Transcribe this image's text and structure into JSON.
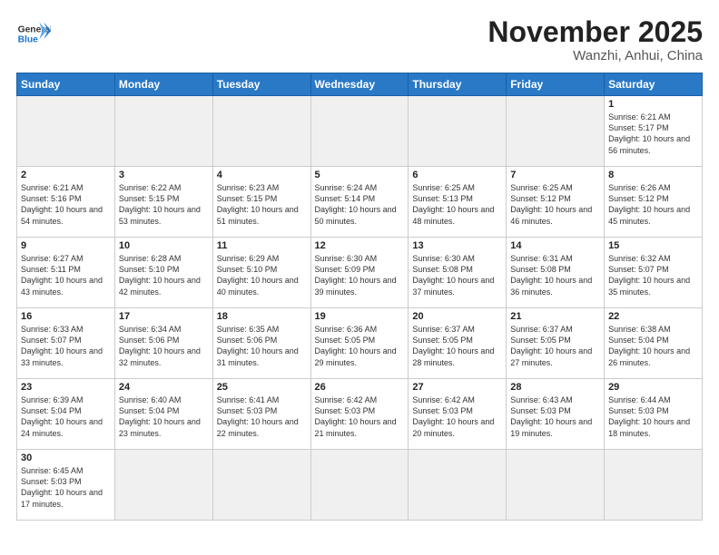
{
  "header": {
    "logo_general": "General",
    "logo_blue": "Blue",
    "month_title": "November 2025",
    "subtitle": "Wanzhi, Anhui, China"
  },
  "days_of_week": [
    "Sunday",
    "Monday",
    "Tuesday",
    "Wednesday",
    "Thursday",
    "Friday",
    "Saturday"
  ],
  "weeks": [
    [
      {
        "day": "",
        "info": ""
      },
      {
        "day": "",
        "info": ""
      },
      {
        "day": "",
        "info": ""
      },
      {
        "day": "",
        "info": ""
      },
      {
        "day": "",
        "info": ""
      },
      {
        "day": "",
        "info": ""
      },
      {
        "day": "1",
        "info": "Sunrise: 6:21 AM\nSunset: 5:17 PM\nDaylight: 10 hours and 56 minutes."
      }
    ],
    [
      {
        "day": "2",
        "info": "Sunrise: 6:21 AM\nSunset: 5:16 PM\nDaylight: 10 hours and 54 minutes."
      },
      {
        "day": "3",
        "info": "Sunrise: 6:22 AM\nSunset: 5:15 PM\nDaylight: 10 hours and 53 minutes."
      },
      {
        "day": "4",
        "info": "Sunrise: 6:23 AM\nSunset: 5:15 PM\nDaylight: 10 hours and 51 minutes."
      },
      {
        "day": "5",
        "info": "Sunrise: 6:24 AM\nSunset: 5:14 PM\nDaylight: 10 hours and 50 minutes."
      },
      {
        "day": "6",
        "info": "Sunrise: 6:25 AM\nSunset: 5:13 PM\nDaylight: 10 hours and 48 minutes."
      },
      {
        "day": "7",
        "info": "Sunrise: 6:25 AM\nSunset: 5:12 PM\nDaylight: 10 hours and 46 minutes."
      },
      {
        "day": "8",
        "info": "Sunrise: 6:26 AM\nSunset: 5:12 PM\nDaylight: 10 hours and 45 minutes."
      }
    ],
    [
      {
        "day": "9",
        "info": "Sunrise: 6:27 AM\nSunset: 5:11 PM\nDaylight: 10 hours and 43 minutes."
      },
      {
        "day": "10",
        "info": "Sunrise: 6:28 AM\nSunset: 5:10 PM\nDaylight: 10 hours and 42 minutes."
      },
      {
        "day": "11",
        "info": "Sunrise: 6:29 AM\nSunset: 5:10 PM\nDaylight: 10 hours and 40 minutes."
      },
      {
        "day": "12",
        "info": "Sunrise: 6:30 AM\nSunset: 5:09 PM\nDaylight: 10 hours and 39 minutes."
      },
      {
        "day": "13",
        "info": "Sunrise: 6:30 AM\nSunset: 5:08 PM\nDaylight: 10 hours and 37 minutes."
      },
      {
        "day": "14",
        "info": "Sunrise: 6:31 AM\nSunset: 5:08 PM\nDaylight: 10 hours and 36 minutes."
      },
      {
        "day": "15",
        "info": "Sunrise: 6:32 AM\nSunset: 5:07 PM\nDaylight: 10 hours and 35 minutes."
      }
    ],
    [
      {
        "day": "16",
        "info": "Sunrise: 6:33 AM\nSunset: 5:07 PM\nDaylight: 10 hours and 33 minutes."
      },
      {
        "day": "17",
        "info": "Sunrise: 6:34 AM\nSunset: 5:06 PM\nDaylight: 10 hours and 32 minutes."
      },
      {
        "day": "18",
        "info": "Sunrise: 6:35 AM\nSunset: 5:06 PM\nDaylight: 10 hours and 31 minutes."
      },
      {
        "day": "19",
        "info": "Sunrise: 6:36 AM\nSunset: 5:05 PM\nDaylight: 10 hours and 29 minutes."
      },
      {
        "day": "20",
        "info": "Sunrise: 6:37 AM\nSunset: 5:05 PM\nDaylight: 10 hours and 28 minutes."
      },
      {
        "day": "21",
        "info": "Sunrise: 6:37 AM\nSunset: 5:05 PM\nDaylight: 10 hours and 27 minutes."
      },
      {
        "day": "22",
        "info": "Sunrise: 6:38 AM\nSunset: 5:04 PM\nDaylight: 10 hours and 26 minutes."
      }
    ],
    [
      {
        "day": "23",
        "info": "Sunrise: 6:39 AM\nSunset: 5:04 PM\nDaylight: 10 hours and 24 minutes."
      },
      {
        "day": "24",
        "info": "Sunrise: 6:40 AM\nSunset: 5:04 PM\nDaylight: 10 hours and 23 minutes."
      },
      {
        "day": "25",
        "info": "Sunrise: 6:41 AM\nSunset: 5:03 PM\nDaylight: 10 hours and 22 minutes."
      },
      {
        "day": "26",
        "info": "Sunrise: 6:42 AM\nSunset: 5:03 PM\nDaylight: 10 hours and 21 minutes."
      },
      {
        "day": "27",
        "info": "Sunrise: 6:42 AM\nSunset: 5:03 PM\nDaylight: 10 hours and 20 minutes."
      },
      {
        "day": "28",
        "info": "Sunrise: 6:43 AM\nSunset: 5:03 PM\nDaylight: 10 hours and 19 minutes."
      },
      {
        "day": "29",
        "info": "Sunrise: 6:44 AM\nSunset: 5:03 PM\nDaylight: 10 hours and 18 minutes."
      }
    ],
    [
      {
        "day": "30",
        "info": "Sunrise: 6:45 AM\nSunset: 5:03 PM\nDaylight: 10 hours and 17 minutes."
      },
      {
        "day": "",
        "info": ""
      },
      {
        "day": "",
        "info": ""
      },
      {
        "day": "",
        "info": ""
      },
      {
        "day": "",
        "info": ""
      },
      {
        "day": "",
        "info": ""
      },
      {
        "day": "",
        "info": ""
      }
    ]
  ]
}
